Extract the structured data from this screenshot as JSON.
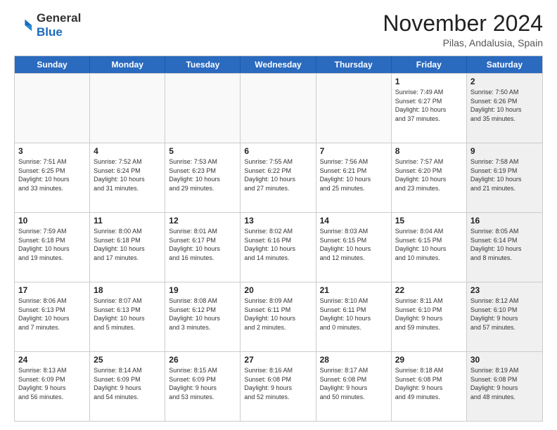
{
  "header": {
    "logo_general": "General",
    "logo_blue": "Blue",
    "month_title": "November 2024",
    "subtitle": "Pilas, Andalusia, Spain"
  },
  "weekdays": [
    "Sunday",
    "Monday",
    "Tuesday",
    "Wednesday",
    "Thursday",
    "Friday",
    "Saturday"
  ],
  "rows": [
    [
      {
        "day": "",
        "info": "",
        "empty": true
      },
      {
        "day": "",
        "info": "",
        "empty": true
      },
      {
        "day": "",
        "info": "",
        "empty": true
      },
      {
        "day": "",
        "info": "",
        "empty": true
      },
      {
        "day": "",
        "info": "",
        "empty": true
      },
      {
        "day": "1",
        "info": "Sunrise: 7:49 AM\nSunset: 6:27 PM\nDaylight: 10 hours\nand 37 minutes.",
        "empty": false,
        "shaded": false
      },
      {
        "day": "2",
        "info": "Sunrise: 7:50 AM\nSunset: 6:26 PM\nDaylight: 10 hours\nand 35 minutes.",
        "empty": false,
        "shaded": true
      }
    ],
    [
      {
        "day": "3",
        "info": "Sunrise: 7:51 AM\nSunset: 6:25 PM\nDaylight: 10 hours\nand 33 minutes.",
        "empty": false,
        "shaded": false
      },
      {
        "day": "4",
        "info": "Sunrise: 7:52 AM\nSunset: 6:24 PM\nDaylight: 10 hours\nand 31 minutes.",
        "empty": false,
        "shaded": false
      },
      {
        "day": "5",
        "info": "Sunrise: 7:53 AM\nSunset: 6:23 PM\nDaylight: 10 hours\nand 29 minutes.",
        "empty": false,
        "shaded": false
      },
      {
        "day": "6",
        "info": "Sunrise: 7:55 AM\nSunset: 6:22 PM\nDaylight: 10 hours\nand 27 minutes.",
        "empty": false,
        "shaded": false
      },
      {
        "day": "7",
        "info": "Sunrise: 7:56 AM\nSunset: 6:21 PM\nDaylight: 10 hours\nand 25 minutes.",
        "empty": false,
        "shaded": false
      },
      {
        "day": "8",
        "info": "Sunrise: 7:57 AM\nSunset: 6:20 PM\nDaylight: 10 hours\nand 23 minutes.",
        "empty": false,
        "shaded": false
      },
      {
        "day": "9",
        "info": "Sunrise: 7:58 AM\nSunset: 6:19 PM\nDaylight: 10 hours\nand 21 minutes.",
        "empty": false,
        "shaded": true
      }
    ],
    [
      {
        "day": "10",
        "info": "Sunrise: 7:59 AM\nSunset: 6:18 PM\nDaylight: 10 hours\nand 19 minutes.",
        "empty": false,
        "shaded": false
      },
      {
        "day": "11",
        "info": "Sunrise: 8:00 AM\nSunset: 6:18 PM\nDaylight: 10 hours\nand 17 minutes.",
        "empty": false,
        "shaded": false
      },
      {
        "day": "12",
        "info": "Sunrise: 8:01 AM\nSunset: 6:17 PM\nDaylight: 10 hours\nand 16 minutes.",
        "empty": false,
        "shaded": false
      },
      {
        "day": "13",
        "info": "Sunrise: 8:02 AM\nSunset: 6:16 PM\nDaylight: 10 hours\nand 14 minutes.",
        "empty": false,
        "shaded": false
      },
      {
        "day": "14",
        "info": "Sunrise: 8:03 AM\nSunset: 6:15 PM\nDaylight: 10 hours\nand 12 minutes.",
        "empty": false,
        "shaded": false
      },
      {
        "day": "15",
        "info": "Sunrise: 8:04 AM\nSunset: 6:15 PM\nDaylight: 10 hours\nand 10 minutes.",
        "empty": false,
        "shaded": false
      },
      {
        "day": "16",
        "info": "Sunrise: 8:05 AM\nSunset: 6:14 PM\nDaylight: 10 hours\nand 8 minutes.",
        "empty": false,
        "shaded": true
      }
    ],
    [
      {
        "day": "17",
        "info": "Sunrise: 8:06 AM\nSunset: 6:13 PM\nDaylight: 10 hours\nand 7 minutes.",
        "empty": false,
        "shaded": false
      },
      {
        "day": "18",
        "info": "Sunrise: 8:07 AM\nSunset: 6:13 PM\nDaylight: 10 hours\nand 5 minutes.",
        "empty": false,
        "shaded": false
      },
      {
        "day": "19",
        "info": "Sunrise: 8:08 AM\nSunset: 6:12 PM\nDaylight: 10 hours\nand 3 minutes.",
        "empty": false,
        "shaded": false
      },
      {
        "day": "20",
        "info": "Sunrise: 8:09 AM\nSunset: 6:11 PM\nDaylight: 10 hours\nand 2 minutes.",
        "empty": false,
        "shaded": false
      },
      {
        "day": "21",
        "info": "Sunrise: 8:10 AM\nSunset: 6:11 PM\nDaylight: 10 hours\nand 0 minutes.",
        "empty": false,
        "shaded": false
      },
      {
        "day": "22",
        "info": "Sunrise: 8:11 AM\nSunset: 6:10 PM\nDaylight: 9 hours\nand 59 minutes.",
        "empty": false,
        "shaded": false
      },
      {
        "day": "23",
        "info": "Sunrise: 8:12 AM\nSunset: 6:10 PM\nDaylight: 9 hours\nand 57 minutes.",
        "empty": false,
        "shaded": true
      }
    ],
    [
      {
        "day": "24",
        "info": "Sunrise: 8:13 AM\nSunset: 6:09 PM\nDaylight: 9 hours\nand 56 minutes.",
        "empty": false,
        "shaded": false
      },
      {
        "day": "25",
        "info": "Sunrise: 8:14 AM\nSunset: 6:09 PM\nDaylight: 9 hours\nand 54 minutes.",
        "empty": false,
        "shaded": false
      },
      {
        "day": "26",
        "info": "Sunrise: 8:15 AM\nSunset: 6:09 PM\nDaylight: 9 hours\nand 53 minutes.",
        "empty": false,
        "shaded": false
      },
      {
        "day": "27",
        "info": "Sunrise: 8:16 AM\nSunset: 6:08 PM\nDaylight: 9 hours\nand 52 minutes.",
        "empty": false,
        "shaded": false
      },
      {
        "day": "28",
        "info": "Sunrise: 8:17 AM\nSunset: 6:08 PM\nDaylight: 9 hours\nand 50 minutes.",
        "empty": false,
        "shaded": false
      },
      {
        "day": "29",
        "info": "Sunrise: 8:18 AM\nSunset: 6:08 PM\nDaylight: 9 hours\nand 49 minutes.",
        "empty": false,
        "shaded": false
      },
      {
        "day": "30",
        "info": "Sunrise: 8:19 AM\nSunset: 6:08 PM\nDaylight: 9 hours\nand 48 minutes.",
        "empty": false,
        "shaded": true
      }
    ]
  ]
}
